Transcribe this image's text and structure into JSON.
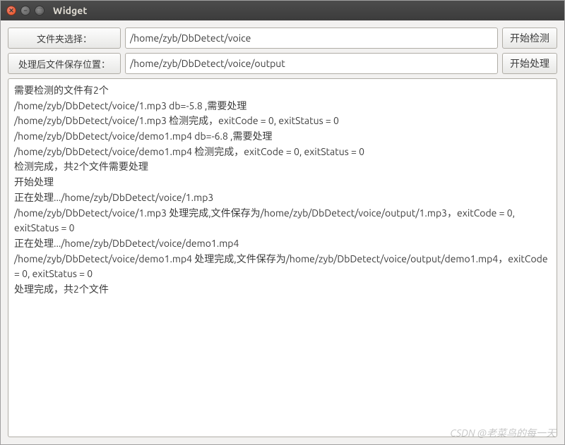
{
  "window": {
    "title": "Widget"
  },
  "row1": {
    "select_folder_label": "文件夹选择：",
    "folder_path": "/home/zyb/DbDetect/voice",
    "start_detect_label": "开始检测"
  },
  "row2": {
    "output_folder_label": "处理后文件保存位置：",
    "output_path": "/home/zyb/DbDetect/voice/output",
    "start_process_label": "开始处理"
  },
  "log": {
    "lines": [
      "需要检测的文件有2个",
      "/home/zyb/DbDetect/voice/1.mp3 db=-5.8 ,需要处理",
      "/home/zyb/DbDetect/voice/1.mp3 检测完成，exitCode = 0, exitStatus = 0",
      "/home/zyb/DbDetect/voice/demo1.mp4 db=-6.8 ,需要处理",
      "/home/zyb/DbDetect/voice/demo1.mp4 检测完成，exitCode = 0, exitStatus = 0",
      "检测完成，共2个文件需要处理",
      "开始处理",
      "正在处理.../home/zyb/DbDetect/voice/1.mp3",
      "/home/zyb/DbDetect/voice/1.mp3 处理完成,文件保存为/home/zyb/DbDetect/voice/output/1.mp3，exitCode = 0, exitStatus = 0",
      "正在处理.../home/zyb/DbDetect/voice/demo1.mp4",
      "/home/zyb/DbDetect/voice/demo1.mp4 处理完成,文件保存为/home/zyb/DbDetect/voice/output/demo1.mp4，exitCode = 0, exitStatus = 0",
      "处理完成，共2个文件"
    ]
  },
  "watermark": "CSDN @老菜鸟的每一天"
}
